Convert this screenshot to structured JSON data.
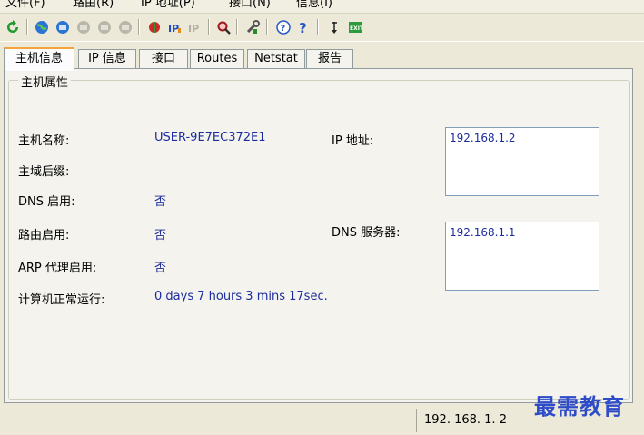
{
  "menubar": {
    "items": [
      {
        "label": "文件(F)"
      },
      {
        "label": "路由(R)"
      },
      {
        "label": "IP 地址(P)"
      },
      {
        "label": "接口(N)"
      },
      {
        "label": "信息(I)"
      }
    ]
  },
  "tabs": [
    {
      "label": "主机信息"
    },
    {
      "label": "IP 信息"
    },
    {
      "label": "接口"
    },
    {
      "label": "Routes"
    },
    {
      "label": "Netstat"
    },
    {
      "label": "报告"
    }
  ],
  "host_panel": {
    "group_title": "主机属性",
    "fields": {
      "hostname": {
        "label": "主机名称:",
        "value": "USER-9E7EC372E1"
      },
      "domain": {
        "label": "主域后缀:",
        "value": ""
      },
      "dns_enabled": {
        "label": "DNS 启用:",
        "value": "否"
      },
      "routing_enabled": {
        "label": "路由启用:",
        "value": "否"
      },
      "arp_proxy": {
        "label": "ARP 代理启用:",
        "value": "否"
      },
      "uptime": {
        "label": "计算机正常运行:",
        "value": "0 days 7 hours 3 mins 17sec."
      }
    },
    "ip_address": {
      "label": "IP 地址:",
      "values": [
        "192.168.1.2"
      ]
    },
    "dns_servers": {
      "label": "DNS 服务器:",
      "values": [
        "192.168.1.1"
      ]
    }
  },
  "statusbar": {
    "ip": "192. 168. 1. 2"
  },
  "watermark": "最需教育",
  "colors": {
    "value_text": "#1B2C9E",
    "active_tab_accent": "#F4A43A",
    "window_bg": "#ECE9D8"
  },
  "toolbar": {
    "icons": [
      "refresh-icon",
      "globe-green-icon",
      "globe-blue-icon",
      "globe-gray-icon",
      "globe-gray-icon-2",
      "globe-gray-icon-3",
      "ip-add-icon",
      "ip-edit-icon",
      "ip-remove-icon",
      "zoom-icon",
      "tools-icon",
      "help-icon",
      "whats-this-icon",
      "pin-icon",
      "exit-icon"
    ]
  }
}
